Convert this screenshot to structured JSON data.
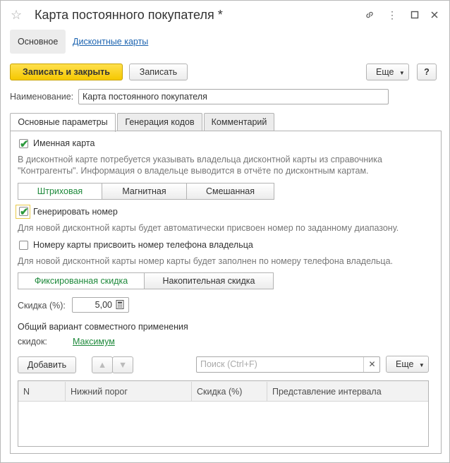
{
  "window": {
    "title": "Карта постоянного покупателя *"
  },
  "nav": {
    "main": "Основное",
    "discount_cards": "Дисконтные карты"
  },
  "toolbar": {
    "save_close": "Записать и закрыть",
    "save": "Записать",
    "more": "Еще",
    "help": "?"
  },
  "name_field": {
    "label": "Наименование:",
    "value": "Карта постоянного покупателя"
  },
  "tabs": [
    "Основные параметры",
    "Генерация кодов",
    "Комментарий"
  ],
  "named_card": {
    "label": "Именная карта",
    "checked": true,
    "hint": "В дисконтной карте потребуется указывать владельца дисконтной карты из справочника \"Контрагенты\". Информация о владельце выводится в отчёте по дисконтным картам."
  },
  "card_type": {
    "options": [
      "Штриховая",
      "Магнитная",
      "Смешанная"
    ],
    "selected": "Штриховая"
  },
  "generate_number": {
    "label": "Генерировать номер",
    "checked": true,
    "hint": "Для новой дисконтной карты будет автоматически присвоен номер по заданному диапазону."
  },
  "phone_number": {
    "label": "Номеру карты присвоить номер телефона владельца",
    "checked": false,
    "hint": "Для новой дисконтной карты номер карты будет заполнен по номеру телефона владельца."
  },
  "discount_type": {
    "options": [
      "Фиксированная скидка",
      "Накопительная скидка"
    ],
    "selected": "Фиксированная скидка"
  },
  "discount": {
    "label": "Скидка (%):",
    "value": "5,00"
  },
  "combine": {
    "label_line1": "Общий вариант совместного применения",
    "label_line2": "скидок:",
    "value": "Максимум"
  },
  "table_toolbar": {
    "add": "Добавить",
    "search_placeholder": "Поиск (Ctrl+F)",
    "more": "Еще"
  },
  "table": {
    "columns": [
      "N",
      "Нижний порог",
      "Скидка (%)",
      "Представление интервала"
    ],
    "rows": []
  }
}
